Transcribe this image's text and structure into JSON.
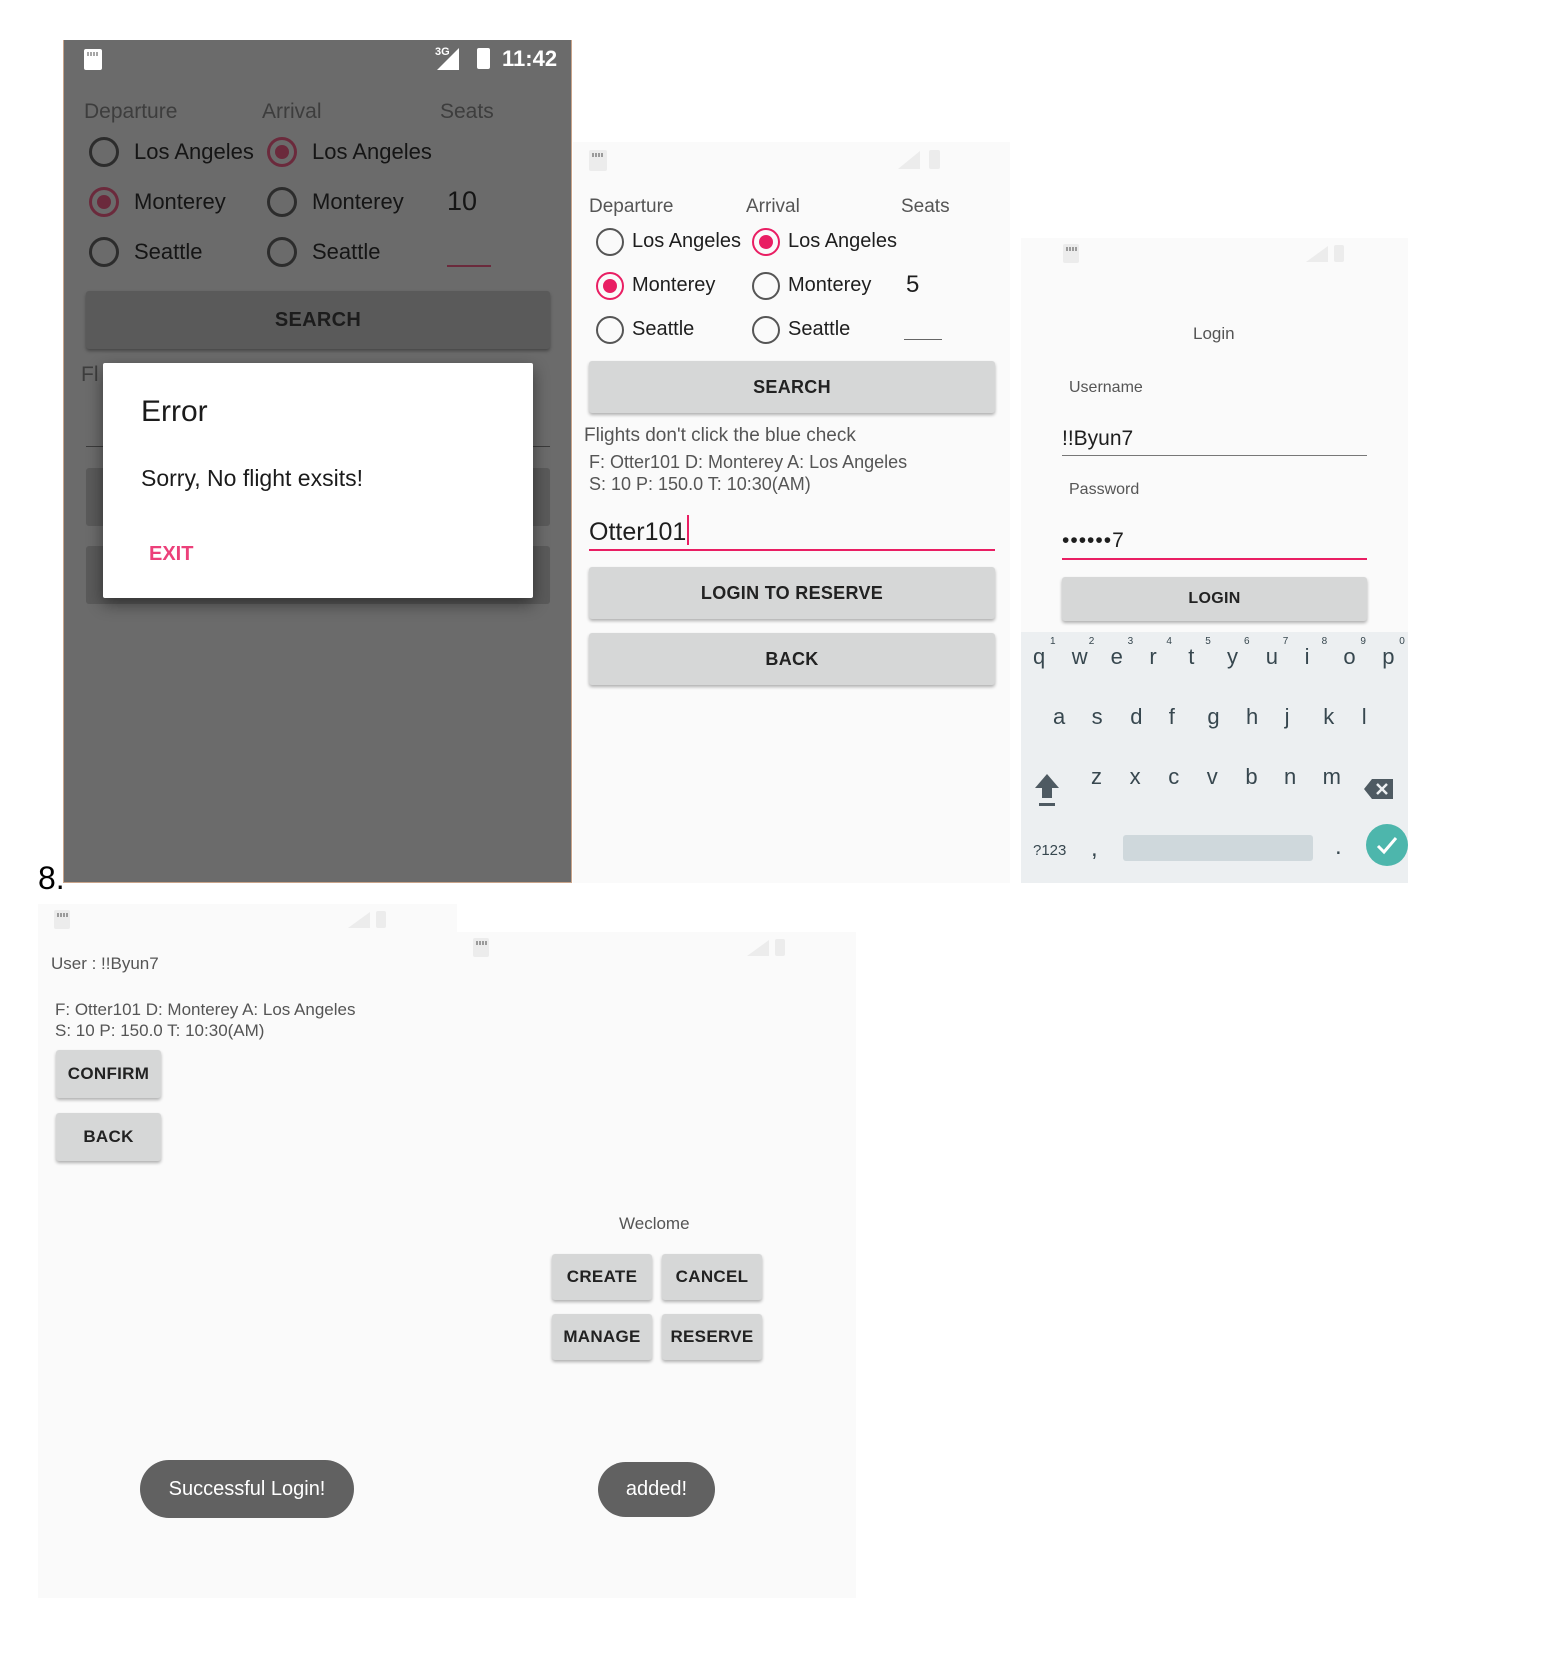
{
  "step_label": "8.",
  "screen1": {
    "status": {
      "clock": "11:42",
      "network": "3G"
    },
    "headers": {
      "departure": "Departure",
      "arrival": "Arrival",
      "seats": "Seats"
    },
    "departure_options": [
      "Los Angeles",
      "Monterey",
      "Seattle"
    ],
    "departure_selected": "Monterey",
    "arrival_options": [
      "Los Angeles",
      "Monterey",
      "Seattle"
    ],
    "arrival_selected": "Los Angeles",
    "seats_value": "10",
    "search_label": "SEARCH",
    "hidden_text_fragment": "Fl",
    "dialog": {
      "title": "Error",
      "message": "Sorry, No flight exsits!",
      "action": "EXIT"
    }
  },
  "screen2": {
    "headers": {
      "departure": "Departure",
      "arrival": "Arrival",
      "seats": "Seats"
    },
    "departure_options": [
      "Los Angeles",
      "Monterey",
      "Seattle"
    ],
    "departure_selected": "Monterey",
    "arrival_options": [
      "Los Angeles",
      "Monterey",
      "Seattle"
    ],
    "arrival_selected": "Los Angeles",
    "seats_value": "5",
    "search_label": "SEARCH",
    "flights_header": "Flights don't click the blue check",
    "flight_line1": "F: Otter101 D: Monterey A: Los Angeles",
    "flight_line2": "S: 10 P: 150.0 T: 10:30(AM)",
    "flight_input_value": "Otter101",
    "login_to_reserve_label": "LOGIN TO RESERVE",
    "back_label": "BACK"
  },
  "screen3": {
    "title": "Login",
    "username_label": "Username",
    "username_value": "!!Byun7",
    "password_label": "Password",
    "password_value": "••••••7",
    "login_label": "LOGIN",
    "keyboard": {
      "digits": [
        "1",
        "2",
        "3",
        "4",
        "5",
        "6",
        "7",
        "8",
        "9",
        "0"
      ],
      "row1": [
        "q",
        "w",
        "e",
        "r",
        "t",
        "y",
        "u",
        "i",
        "o",
        "p"
      ],
      "row2": [
        "a",
        "s",
        "d",
        "f",
        "g",
        "h",
        "j",
        "k",
        "l"
      ],
      "row3": [
        "z",
        "x",
        "c",
        "v",
        "b",
        "n",
        "m"
      ],
      "symbols_key": "?123",
      "comma_key": ",",
      "period_key": "."
    }
  },
  "screen4": {
    "user_line": "User : !!Byun7",
    "flight_line1": "F: Otter101 D: Monterey A: Los Angeles",
    "flight_line2": "S: 10 P: 150.0 T: 10:30(AM)",
    "confirm_label": "CONFIRM",
    "back_label": "BACK",
    "toast": "Successful Login!"
  },
  "screen5": {
    "title": "Weclome",
    "create_label": "CREATE",
    "cancel_label": "CANCEL",
    "manage_label": "MANAGE",
    "reserve_label": "RESERVE",
    "toast": "added!"
  },
  "colors": {
    "accent": "#e91e63",
    "dim_overlay": "#6b6b6b",
    "button": "#d6d7d7",
    "keyboard_bg": "#eceff1",
    "enter_key": "#4db6ac"
  }
}
